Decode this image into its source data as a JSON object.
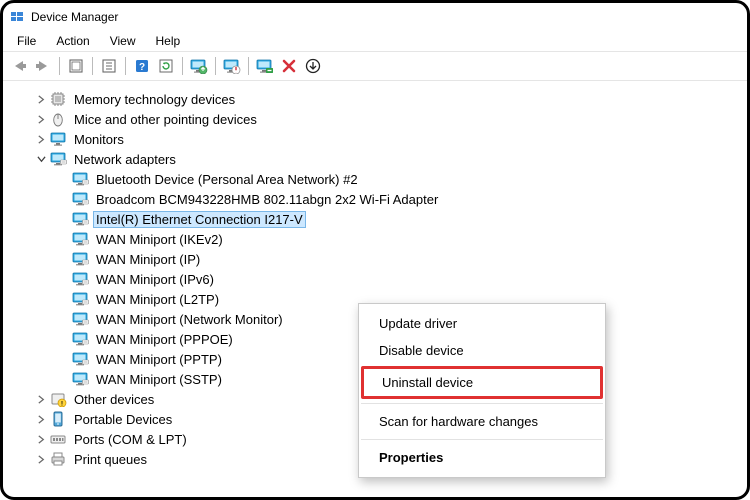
{
  "window": {
    "title": "Device Manager"
  },
  "menubar": {
    "items": [
      "File",
      "Action",
      "View",
      "Help"
    ]
  },
  "toolbar": {
    "buttons": [
      "back",
      "forward",
      "sep",
      "show-hidden",
      "sep",
      "properties",
      "sep",
      "help",
      "refresh",
      "sep",
      "update-driver",
      "sep",
      "disable",
      "sep",
      "uninstall",
      "x",
      "scan-hardware"
    ]
  },
  "tree": {
    "categories": [
      {
        "label": "Memory technology devices",
        "icon": "chip",
        "expanded": false
      },
      {
        "label": "Mice and other pointing devices",
        "icon": "mouse",
        "expanded": false
      },
      {
        "label": "Monitors",
        "icon": "monitor",
        "expanded": false
      },
      {
        "label": "Network adapters",
        "icon": "net",
        "expanded": true,
        "children": [
          {
            "label": "Bluetooth Device (Personal Area Network) #2",
            "icon": "net"
          },
          {
            "label": "Broadcom BCM943228HMB 802.11abgn 2x2 Wi-Fi Adapter",
            "icon": "net"
          },
          {
            "label": "Intel(R) Ethernet Connection I217-V",
            "icon": "net",
            "selected": true
          },
          {
            "label": "WAN Miniport (IKEv2)",
            "icon": "net"
          },
          {
            "label": "WAN Miniport (IP)",
            "icon": "net"
          },
          {
            "label": "WAN Miniport (IPv6)",
            "icon": "net"
          },
          {
            "label": "WAN Miniport (L2TP)",
            "icon": "net"
          },
          {
            "label": "WAN Miniport (Network Monitor)",
            "icon": "net"
          },
          {
            "label": "WAN Miniport (PPPOE)",
            "icon": "net"
          },
          {
            "label": "WAN Miniport (PPTP)",
            "icon": "net"
          },
          {
            "label": "WAN Miniport (SSTP)",
            "icon": "net"
          }
        ]
      },
      {
        "label": "Other devices",
        "icon": "other",
        "expanded": false,
        "badge": "warn"
      },
      {
        "label": "Portable Devices",
        "icon": "portable",
        "expanded": false
      },
      {
        "label": "Ports (COM & LPT)",
        "icon": "port",
        "expanded": false
      },
      {
        "label": "Print queues",
        "icon": "printer",
        "expanded": false
      }
    ]
  },
  "context_menu": {
    "items": [
      {
        "label": "Update driver"
      },
      {
        "label": "Disable device"
      },
      {
        "label": "Uninstall device",
        "highlighted": true
      },
      {
        "divider": true
      },
      {
        "label": "Scan for hardware changes"
      },
      {
        "divider": true
      },
      {
        "label": "Properties",
        "bold": true
      }
    ]
  }
}
